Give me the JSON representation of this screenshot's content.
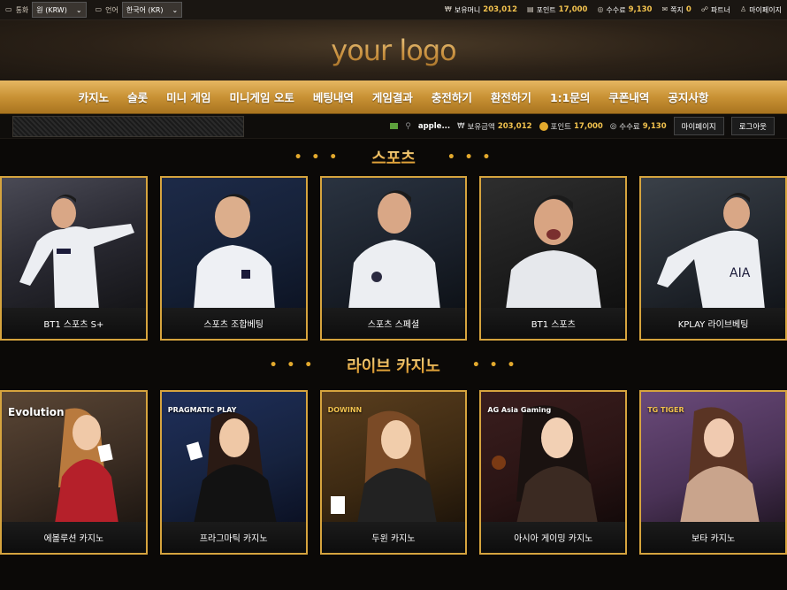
{
  "topbar": {
    "currency_label": "통화",
    "currency_value": "원 (KRW)",
    "language_label": "언어",
    "language_value": "한국어 (KR)",
    "balance_label": "보유머니",
    "balance_value": "203,012",
    "point_label": "포인트",
    "point_value": "17,000",
    "fee_label": "수수료",
    "fee_value": "9,130",
    "message_label": "쪽지",
    "message_value": "0",
    "partner_label": "파트너",
    "mypage_label": "마이페이지"
  },
  "logo": "your logo",
  "nav": [
    "카지노",
    "슬롯",
    "미니 게임",
    "미니게임 오토",
    "베팅내역",
    "게임결과",
    "충전하기",
    "환전하기",
    "1:1문의",
    "쿠폰내역",
    "공지사항"
  ],
  "subbar": {
    "username": "apple...",
    "balance_label": "보유금액",
    "balance_value": "203,012",
    "point_label": "포인트",
    "point_value": "17,000",
    "fee_label": "수수료",
    "fee_value": "9,130",
    "mypage_button": "마이페이지",
    "logout_button": "로그아웃"
  },
  "sections": {
    "sports": {
      "title": "스포츠",
      "cards": [
        "BT1 스포츠 S+",
        "스포츠 조합베팅",
        "스포츠 스페셜",
        "BT1 스포츠",
        "KPLAY 라이브베팅"
      ]
    },
    "casino": {
      "title": "라이브 카지노",
      "cards": [
        "에볼루션 카지노",
        "프라그마틱 카지노",
        "두윈 카지노",
        "아시아 게이밍 카지노",
        "보타 카지노"
      ],
      "brands": [
        "Evolution",
        "PRAGMATIC PLAY",
        "DOWINN",
        "AG Asia Gaming",
        "TG TIGER"
      ]
    }
  },
  "colors": {
    "accent_gold": "#d6a43e",
    "value_yellow": "#f2c24e"
  }
}
